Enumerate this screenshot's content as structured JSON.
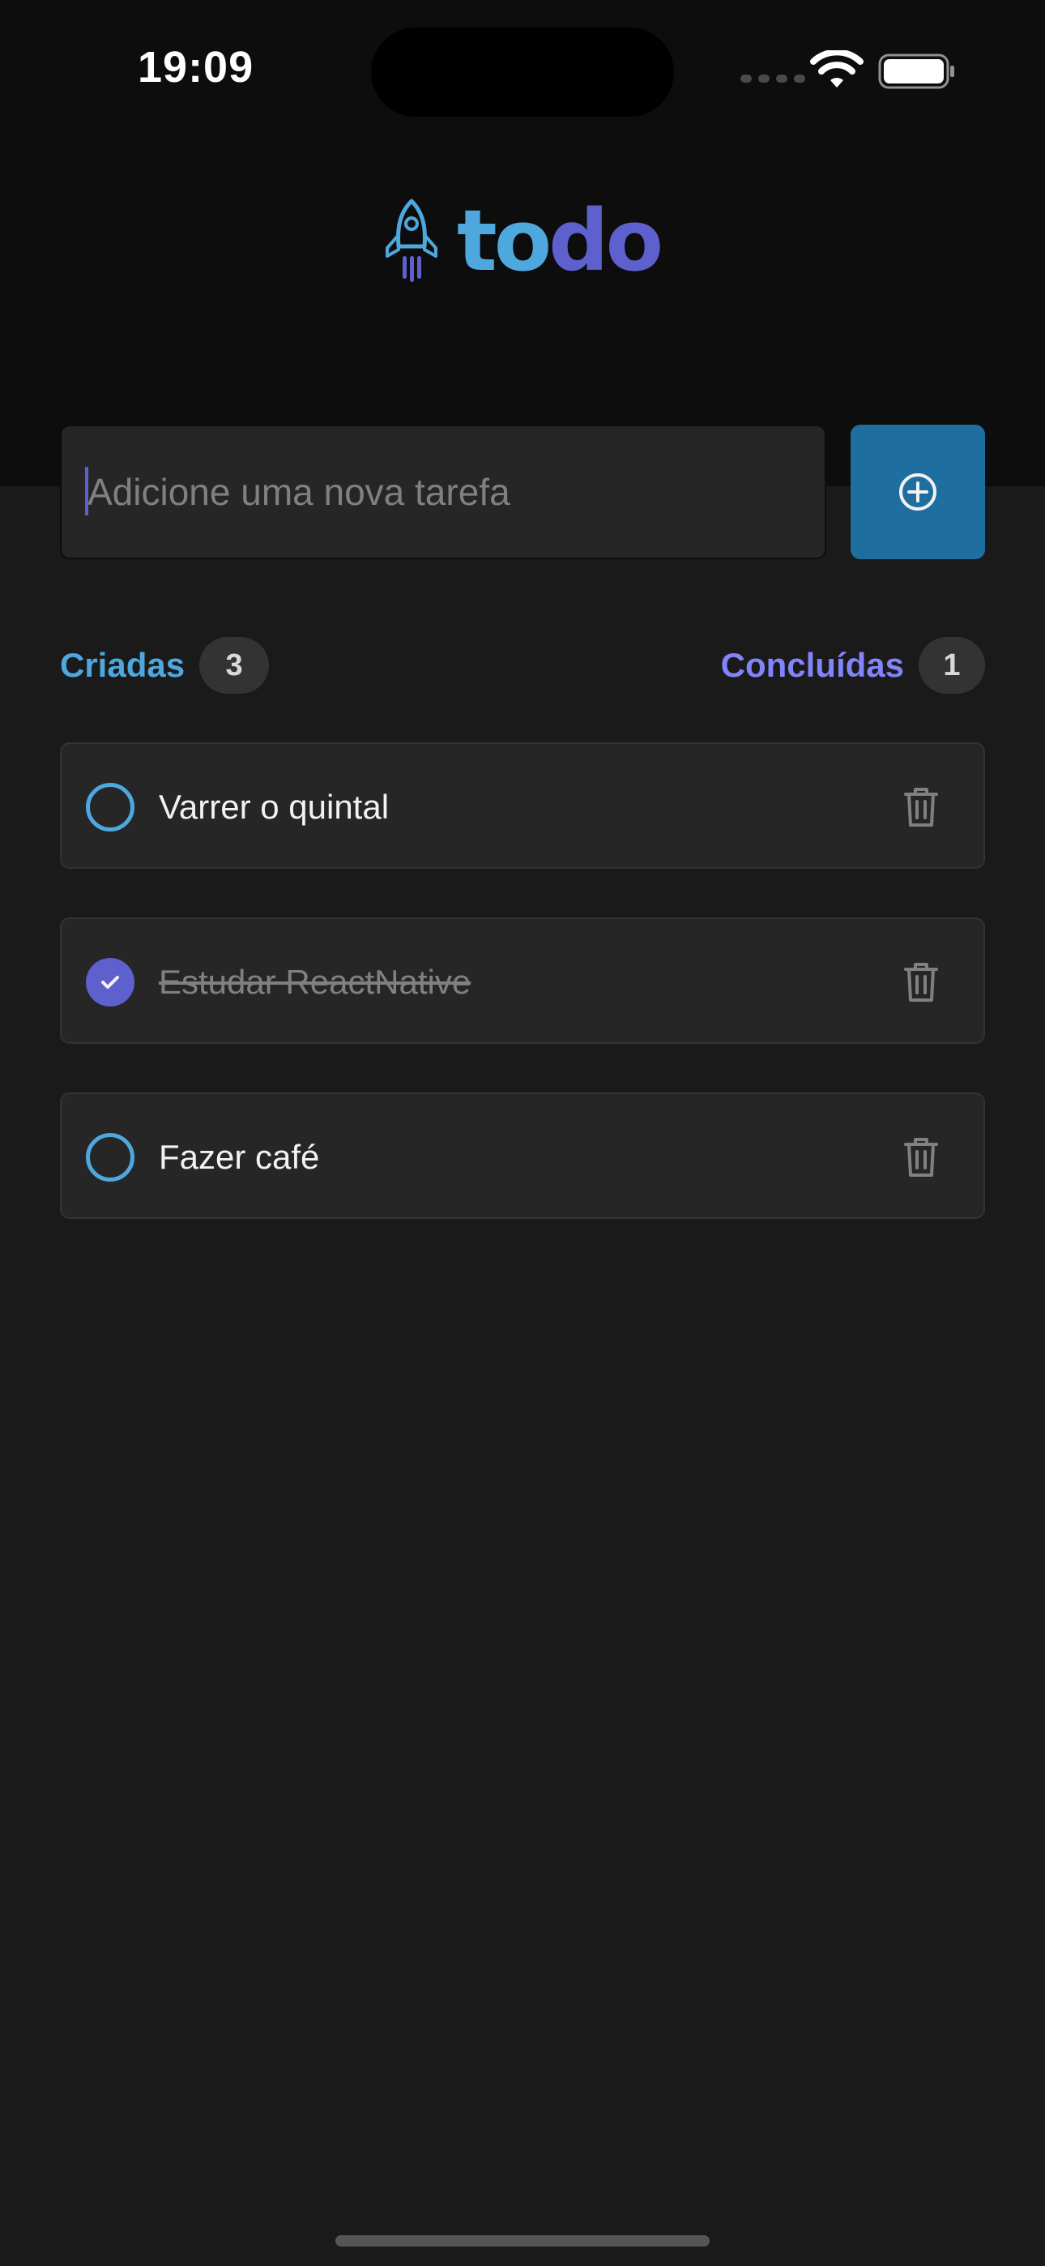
{
  "status_bar": {
    "time": "19:09",
    "icons": [
      "cellular-signal-icon",
      "wifi-icon",
      "battery-icon"
    ]
  },
  "logo": {
    "icon": "rocket-icon",
    "word_part1": "to",
    "word_part2": "do"
  },
  "new_task": {
    "placeholder": "Adicione uma nova tarefa",
    "value": "",
    "add_icon": "plus-circle-icon"
  },
  "counters": {
    "created": {
      "label": "Criadas",
      "count": "3"
    },
    "done": {
      "label": "Concluídas",
      "count": "1"
    }
  },
  "tasks": [
    {
      "text": "Varrer o quintal",
      "completed": false,
      "delete_icon": "trash-icon"
    },
    {
      "text": "Estudar ReactNative",
      "completed": true,
      "delete_icon": "trash-icon"
    },
    {
      "text": "Fazer café",
      "completed": false,
      "delete_icon": "trash-icon"
    }
  ],
  "colors": {
    "background": "#1A1A1A",
    "header": "#0D0D0D",
    "blue": "#4EA8DE",
    "blue_dark": "#1E6F9F",
    "purple": "#5E60CE",
    "purple_light": "#8284FA",
    "card": "#262626"
  }
}
